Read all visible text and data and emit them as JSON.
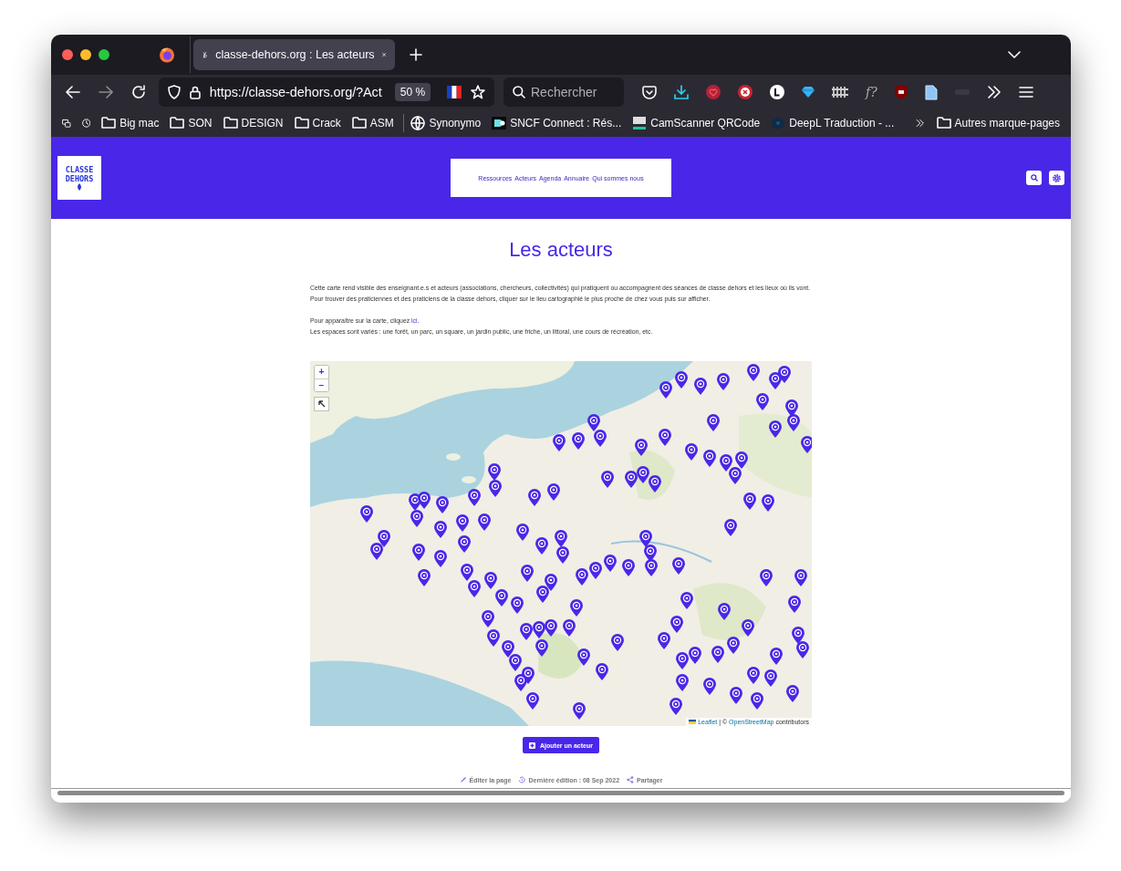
{
  "browser": {
    "tabs": [
      {
        "title": "classe-dehors.org : Les acteurs",
        "selected": true
      }
    ],
    "url": "https://classe-dehors.org/?Act",
    "zoom": "50 %",
    "search_placeholder": "Rechercher",
    "extension_label": "f?",
    "bookmarks": [
      {
        "label": "Big mac",
        "kind": "folder"
      },
      {
        "label": "SON",
        "kind": "folder"
      },
      {
        "label": "DESIGN",
        "kind": "folder"
      },
      {
        "label": "Crack",
        "kind": "folder"
      },
      {
        "label": "ASM",
        "kind": "folder"
      },
      {
        "label": "Synonymo",
        "kind": "globe"
      },
      {
        "label": "SNCF Connect : Rés...",
        "kind": "sncf"
      },
      {
        "label": "CamScanner QRCode",
        "kind": "camscanner"
      },
      {
        "label": "DeepL Traduction - ...",
        "kind": "deepl"
      }
    ],
    "other_bookmarks": "Autres marque-pages"
  },
  "site": {
    "logo_lines": [
      "CLASSE",
      "DEHORS"
    ],
    "nav": [
      "Ressources",
      "Acteurs",
      "Agenda",
      "Annuaire",
      "Qui sommes nous"
    ]
  },
  "page": {
    "title": "Les acteurs",
    "intro": "Cette carte rend visible des enseignant.e.s et acteurs (associations, chercheurs, collectivités) qui pratiquent ou accompagnent des séances de classe dehors et les lieux où ils vont. Pour trouver des praticiennes et des praticiens de la classe dehors, cliquer sur le lieu cartographié le plus proche de chez vous puis sur afficher.",
    "join_before": "Pour apparaître sur la carte, cliquez ",
    "join_link": "ici",
    "join_after": ".",
    "spaces": "Les espaces sont variés : une forêt, un parc, un square, un jardin public, une friche, un littoral, une cours de récréation, etc.",
    "map": {
      "zoom_in": "+",
      "zoom_out": "−",
      "attribution_link": "Leaflet",
      "attribution_sep": " | © ",
      "attribution_osm": "OpenStreetMap",
      "attribution_end": " contributors"
    },
    "add_button": "Ajouter un acteur",
    "footer": [
      {
        "kind": "edit",
        "label": "Éditer la page"
      },
      {
        "kind": "history",
        "label": "Dernière édition : 08 Sep 2022"
      },
      {
        "kind": "share",
        "label": "Partager"
      }
    ]
  }
}
